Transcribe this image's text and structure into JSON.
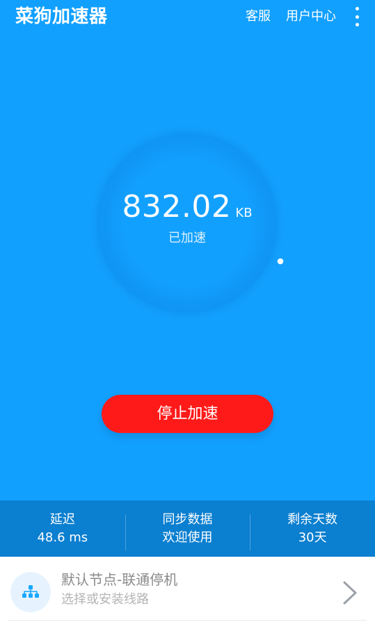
{
  "header": {
    "title": "菜狗加速器",
    "actions": {
      "support": "客服",
      "user_center": "用户中心"
    },
    "menu_icon": "more-vertical-icon"
  },
  "main": {
    "accelerated_value": "832.02",
    "accelerated_unit": "KB",
    "accelerated_caption": "已加速",
    "stop_button_label": "停止加速"
  },
  "stats": [
    {
      "label": "延迟",
      "value": "48.6 ms"
    },
    {
      "label": "同步数据",
      "value": "欢迎使用"
    },
    {
      "label": "剩余天数",
      "value": "30天"
    }
  ],
  "node": {
    "title": "默认节点-联通停机",
    "subtitle": "选择或安装线路",
    "icon": "network-nodes-icon",
    "chevron_icon": "chevron-right-icon"
  },
  "colors": {
    "primary": "#12a0ff",
    "stats_bar": "#0b7fd0",
    "stop_button": "#ff1a1a"
  }
}
